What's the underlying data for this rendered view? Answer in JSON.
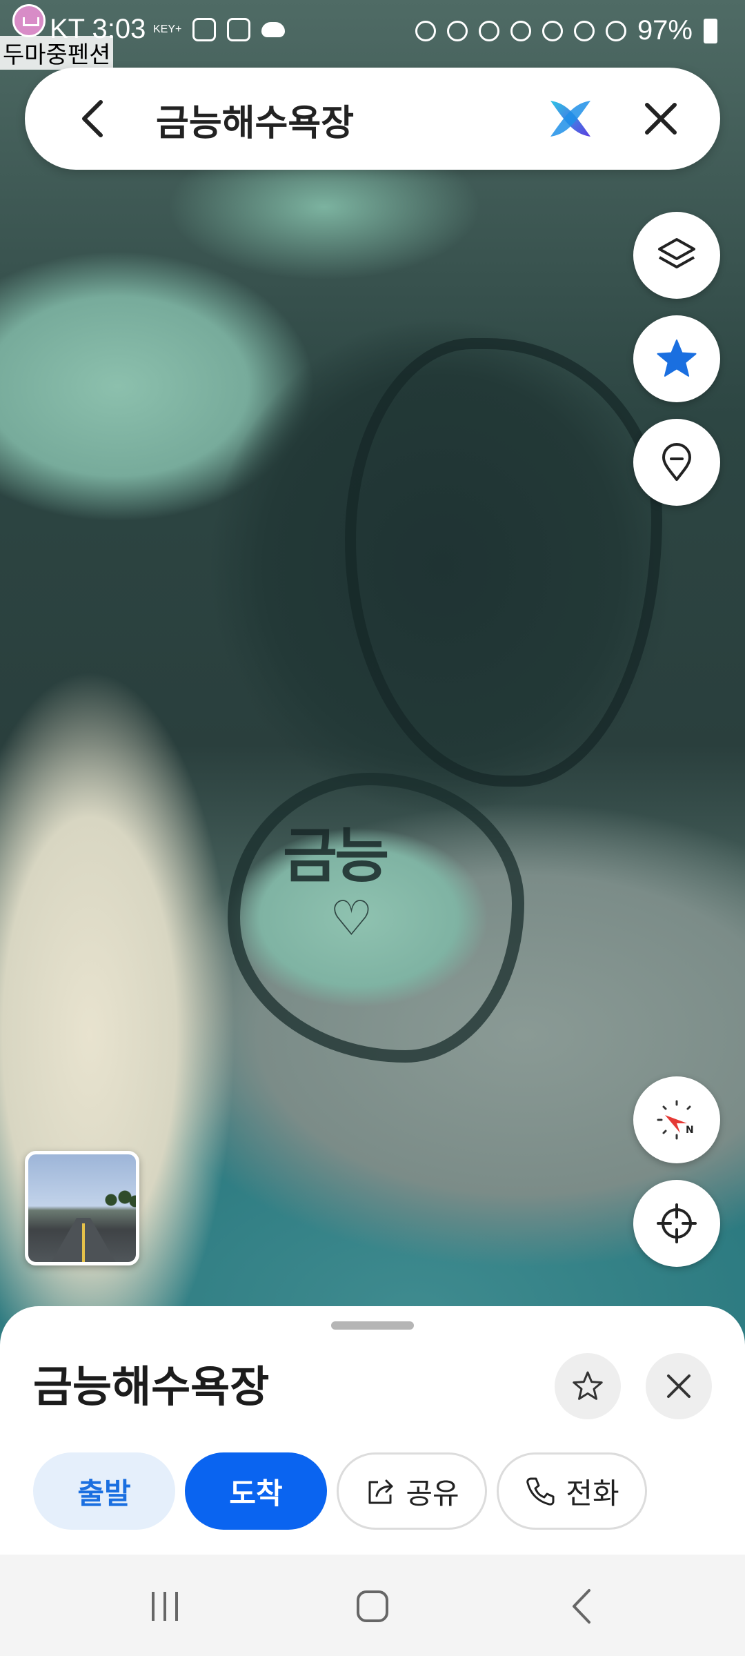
{
  "status_bar": {
    "carrier_time": "KT 3:03",
    "key_badge": "KEY+",
    "battery": "97%",
    "notification_overlay": "두마중펜션",
    "icons": [
      "instagram-icon",
      "gallery-icon",
      "cloud-icon",
      "battery-saver-icon",
      "alarm-icon",
      "mute-icon",
      "location-icon",
      "wifi-icon",
      "hd-icon",
      "signal-icon",
      "battery-icon"
    ]
  },
  "search": {
    "query": "금능해수욕장",
    "icons": [
      "back-arrow-icon",
      "ai-assistant-icon",
      "close-icon"
    ]
  },
  "map": {
    "carved_text": "금능",
    "carved_heart": "♡",
    "controls": [
      "layers-icon",
      "favorite-star-icon",
      "place-pin-icon",
      "compass-icon",
      "current-location-icon"
    ]
  },
  "sheet": {
    "place_name": "금능해수욕장",
    "buttons": {
      "depart": "출발",
      "arrive": "도착",
      "share": "공유",
      "call": "전화"
    }
  },
  "colors": {
    "accent_blue": "#0a64f0",
    "light_blue": "#e5effb",
    "compass_red": "#e53935"
  }
}
